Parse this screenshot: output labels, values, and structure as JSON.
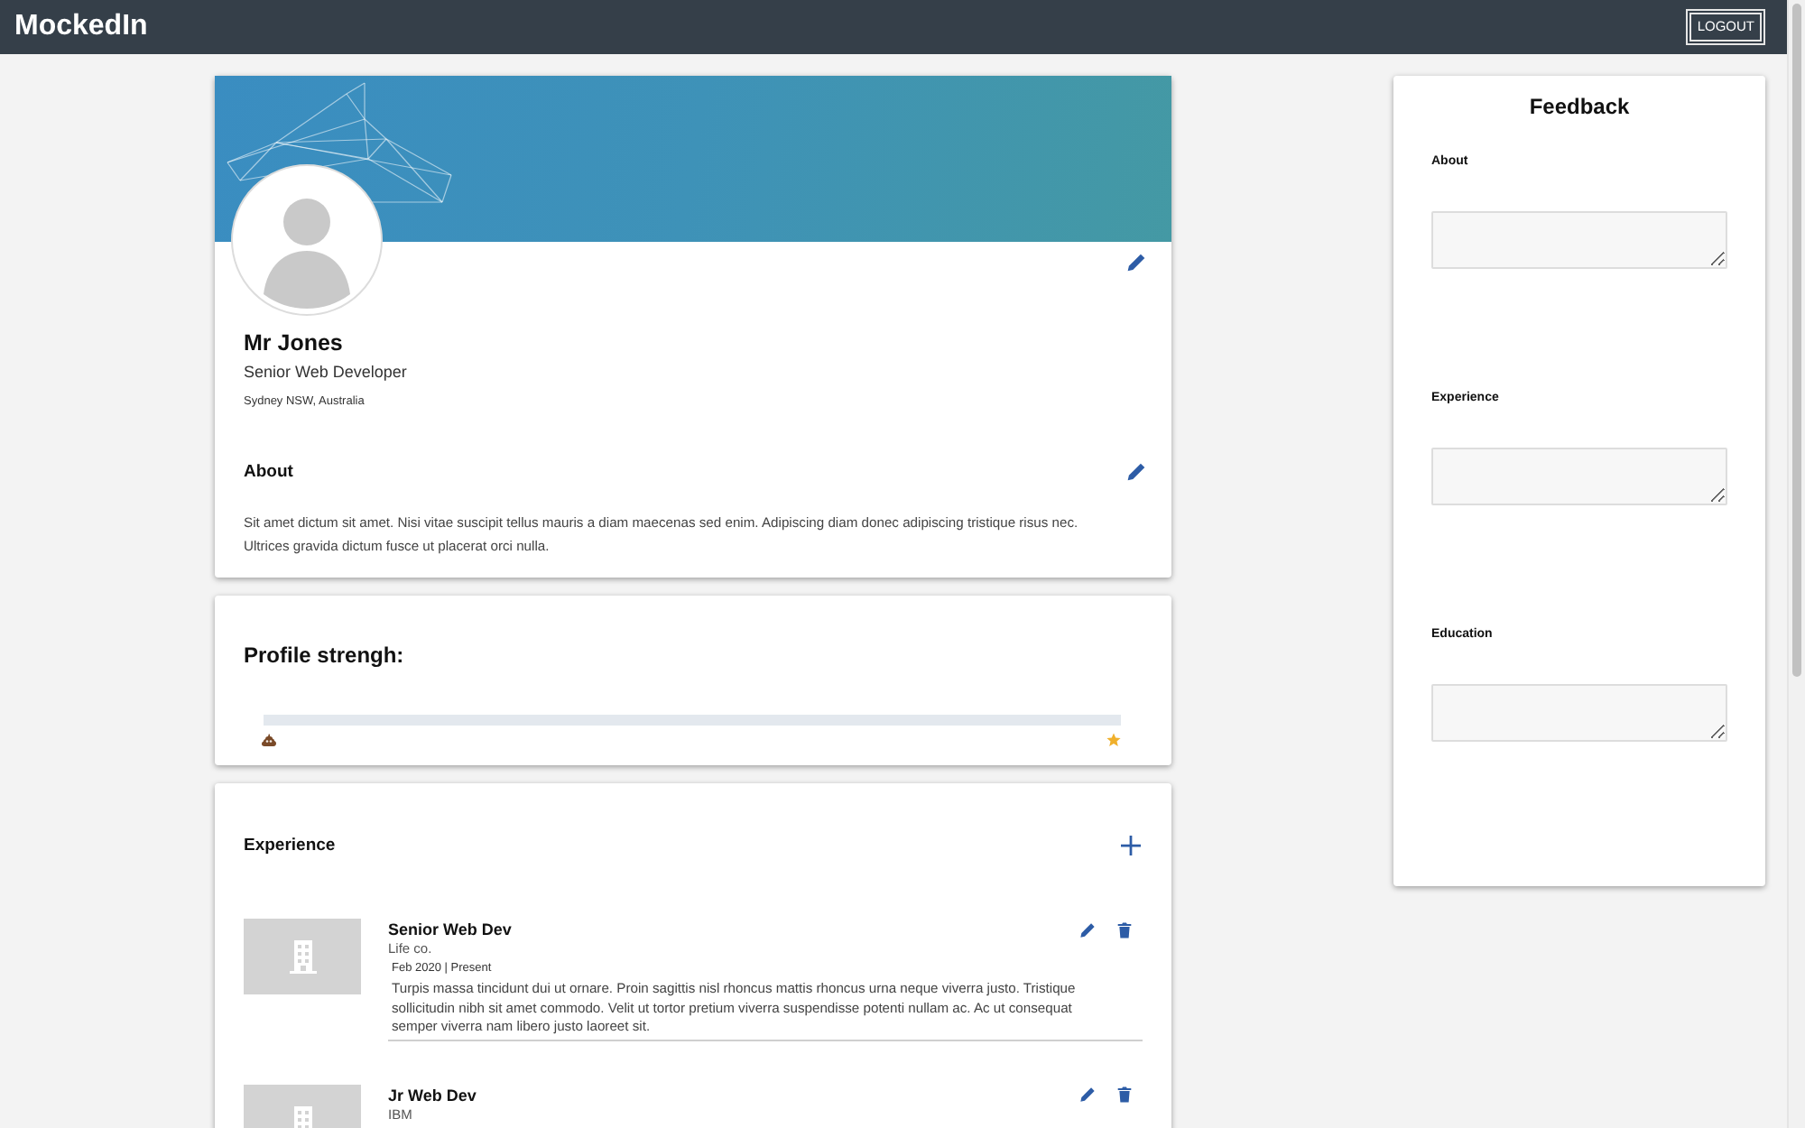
{
  "header": {
    "logo": "MockedIn",
    "logout_button": "LOGOUT"
  },
  "profile": {
    "name": "Mr Jones",
    "headline": "Senior Web Developer",
    "location": "Sydney NSW, Australia",
    "about": {
      "title": "About",
      "text": "Sit amet dictum sit amet. Nisi vitae suscipit tellus mauris a diam maecenas sed enim. Adipiscing diam donec adipiscing tristique risus nec. Ultrices gravida dictum fusce ut placerat orci nulla."
    }
  },
  "profile_strength": {
    "title": "Profile strengh:"
  },
  "experience": {
    "title": "Experience",
    "items": [
      {
        "title": "Senior Web Dev",
        "company": "Life co.",
        "dates": "Feb 2020 | Present",
        "description": "Turpis massa tincidunt dui ut ornare. Proin sagittis nisl rhoncus mattis rhoncus urna neque viverra justo. Tristique sollicitudin nibh sit amet commodo. Velit ut tortor pretium viverra suspendisse potenti nullam ac. Ac ut consequat semper viverra nam libero justo laoreet sit."
      },
      {
        "title": "Jr Web Dev",
        "company": "IBM"
      }
    ]
  },
  "feedback": {
    "title": "Feedback",
    "sections": [
      {
        "label": "About"
      },
      {
        "label": "Experience"
      },
      {
        "label": "Education"
      }
    ]
  }
}
